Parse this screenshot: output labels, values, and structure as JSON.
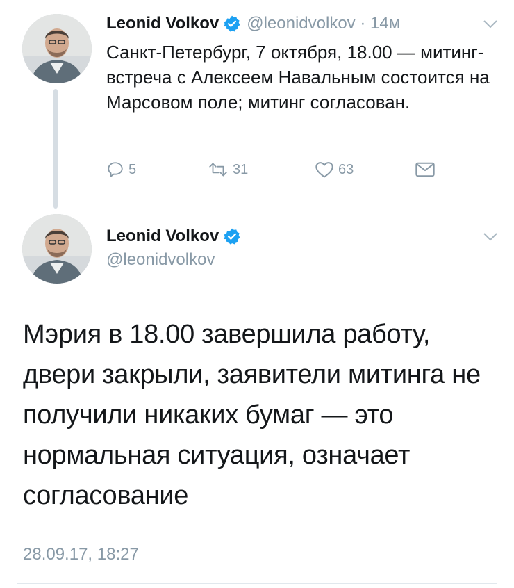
{
  "colors": {
    "verified": "#1da1f2",
    "text": "#14171a",
    "muted": "#8899a6",
    "thread_line": "#d6dde3"
  },
  "tweet1": {
    "author_name": "Leonid Volkov",
    "handle_time": "@leonidvolkov · 14м",
    "text": "Санкт-Петербург, 7 октября, 18.00 — митинг-встреча с Алексеем Навальным состоится на Марсовом поле; митинг согласован.",
    "reply_count": "5",
    "retweet_count": "31",
    "like_count": "63"
  },
  "tweet2": {
    "author_name": "Leonid Volkov",
    "handle": "@leonidvolkov",
    "text": "Мэрия в 18.00 завершила работу, двери закрыли, заявители митинга не получили никаких бумаг — это нормальная ситуация, означает согласование",
    "timestamp": "28.09.17, 18:27"
  },
  "icons": [
    "verified-badge-icon",
    "chevron-down-icon",
    "reply-icon",
    "retweet-icon",
    "like-icon",
    "direct-message-icon"
  ]
}
